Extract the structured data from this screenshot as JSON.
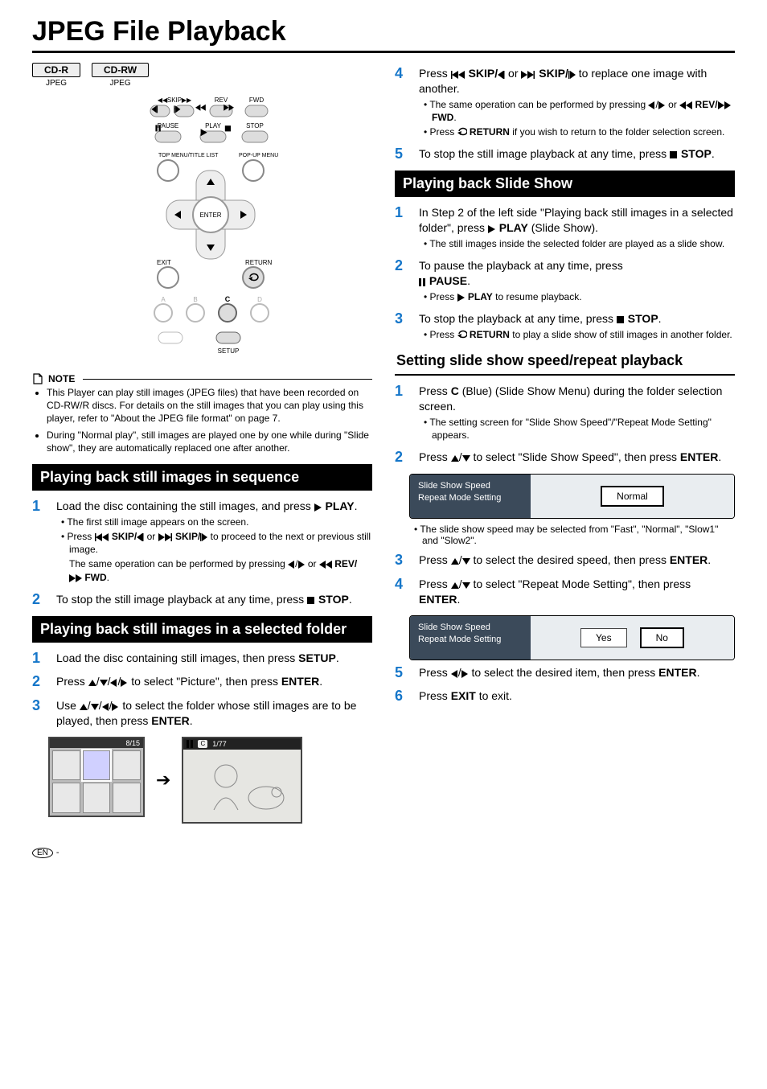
{
  "title": "JPEG File Playback",
  "badges": [
    {
      "label": "CD-R",
      "sub": "JPEG"
    },
    {
      "label": "CD-RW",
      "sub": "JPEG"
    }
  ],
  "remote": {
    "row1": [
      "SKIP",
      "REV",
      "FWD"
    ],
    "row2": [
      "PAUSE",
      "PLAY",
      "STOP"
    ],
    "topmenu": "TOP MENU/TITLE LIST",
    "popup": "POP-UP MENU",
    "enter": "ENTER",
    "exit": "EXIT",
    "return": "RETURN",
    "letters": [
      "A",
      "B",
      "C",
      "D"
    ],
    "setup": "SETUP"
  },
  "note_title": "NOTE",
  "notes": [
    "This Player can play still images (JPEG files) that have been recorded on CD-RW/R discs. For details on the still images that you can play using this player, refer to \"About the JPEG file format\" on page 7.",
    "During \"Normal play\", still images are played one by one while during \"Slide show\", they are automatically replaced one after another."
  ],
  "left_sections": [
    {
      "heading": "Playing back still images in sequence",
      "steps": [
        {
          "n": "1",
          "body_prefix": "Load the disc containing the still images, and press ",
          "icon": "play",
          "bold": "PLAY",
          "suffix": ".",
          "subs": [
            {
              "text": "The first still image appears on the screen."
            },
            {
              "rich": true
            }
          ]
        },
        {
          "n": "2",
          "body_prefix": "To stop the still image playback at any time, press ",
          "icon": "stop",
          "bold": "STOP",
          "suffix": "."
        }
      ],
      "proceed_line1_a": "Press ",
      "proceed_line1_b": " SKIP/",
      "proceed_line1_c": " or ",
      "proceed_line1_d": " SKIP/",
      "proceed_line1_e": " to proceed to the next or previous still image.",
      "proceed_line2_a": "The same operation can be performed by pressing ",
      "proceed_line2_b": " or ",
      "proceed_line2_c": " REV/",
      "proceed_line2_d": " FWD",
      "proceed_line2_e": "."
    },
    {
      "heading": "Playing back still images in a selected folder",
      "steps": [
        {
          "n": "1",
          "body_prefix": "Load the disc containing still images, then press ",
          "bold": "SETUP",
          "suffix": "."
        },
        {
          "n": "2",
          "body_prefix": "Press ",
          "arrows4": true,
          "mid": " to select \"Picture\", then press ",
          "bold": "ENTER",
          "suffix": "."
        },
        {
          "n": "3",
          "body_prefix": "Use ",
          "arrows4": true,
          "mid": " to select the folder whose still images are to be played, then press ",
          "bold": "ENTER",
          "suffix": "."
        }
      ],
      "thumb_top": "8/15",
      "preview_counter": "1/77"
    }
  ],
  "right_top_steps": [
    {
      "n": "4",
      "prefix": "Press ",
      "b1": " SKIP/",
      "or_text": " or ",
      "b2": " SKIP/",
      "suffix": " to replace one image with another.",
      "subs": [
        {
          "a": "The same operation can be performed by pressing ",
          "b": " or ",
          "c": " REV/",
          "d": " FWD",
          "e": "."
        },
        {
          "a": "Press ",
          "bold": "RETURN",
          "b": " if you wish to return to the folder selection screen."
        }
      ]
    },
    {
      "n": "5",
      "prefix": "To stop the still image playback at any time, press ",
      "icon": "stop",
      "bold": "STOP",
      "suffix": "."
    }
  ],
  "slide_show": {
    "heading": "Playing back Slide Show",
    "steps": [
      {
        "n": "1",
        "prefix": "In Step 2 of the left side \"Playing back still images in a selected folder\", press ",
        "icon": "play",
        "bold": "PLAY",
        "suffix": " (Slide Show).",
        "sub": "The still images inside the selected folder are played as a slide show."
      },
      {
        "n": "2",
        "prefix": "To pause the playback at any time, press ",
        "icon": "pause",
        "bold": "PAUSE",
        "suffix": ".",
        "sub_prefix": "Press ",
        "sub_icon": "play",
        "sub_bold": "PLAY",
        "sub_suffix": " to resume playback."
      },
      {
        "n": "3",
        "prefix": "To stop the playback at any time, press ",
        "icon": "stop",
        "bold": "STOP",
        "suffix": ".",
        "sub_prefix": "Press ",
        "sub_return_icon": true,
        "sub_bold": "RETURN",
        "sub_suffix": " to play a slide show of still images in another folder."
      }
    ]
  },
  "speed_repeat": {
    "heading": "Setting slide show speed/repeat playback",
    "steps": [
      {
        "n": "1",
        "prefix": "Press ",
        "bold": "C",
        "mid": " (Blue) (Slide Show Menu) during the folder selection screen.",
        "sub": "The setting screen for \"Slide Show Speed\"/\"Repeat Mode Setting\" appears."
      },
      {
        "n": "2",
        "prefix": "Press ",
        "arrows2": true,
        "mid": " to select \"Slide Show Speed\", then press ",
        "bold2": "ENTER",
        "suffix": "."
      },
      {
        "menu1_left1": "Slide Show Speed",
        "menu1_left2": "Repeat Mode Setting",
        "menu1_opt": "Normal"
      },
      {
        "sub_only": "The slide show speed may be selected from \"Fast\", \"Normal\", \"Slow1\" and \"Slow2\"."
      },
      {
        "n": "3",
        "prefix": "Press ",
        "arrows2": true,
        "mid": " to select the desired speed, then press ",
        "bold2": "ENTER",
        "suffix": "."
      },
      {
        "n": "4",
        "prefix": "Press ",
        "arrows2": true,
        "mid": " to select \"Repeat Mode Setting\", then press ",
        "bold2": "ENTER",
        "suffix": "."
      },
      {
        "menu2_left1": "Slide Show Speed",
        "menu2_left2": "Repeat Mode Setting",
        "menu2_opt1": "Yes",
        "menu2_opt2": "No"
      },
      {
        "n": "5",
        "prefix": "Press ",
        "arrowsLR": true,
        "mid": " to select the desired item, then press ",
        "bold2": "ENTER",
        "suffix": "."
      },
      {
        "n": "6",
        "prefix": "Press ",
        "bold": "EXIT",
        "mid": " to exit."
      }
    ]
  },
  "footer": {
    "en": "EN",
    "dash": "-"
  }
}
